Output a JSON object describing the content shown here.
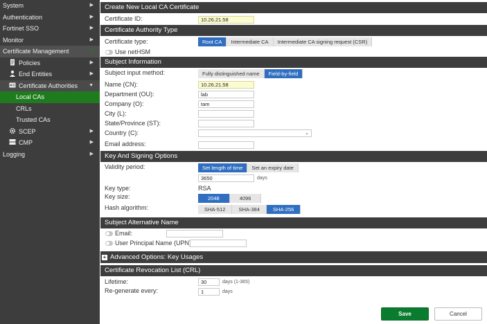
{
  "sidebar": {
    "items": [
      {
        "label": "System"
      },
      {
        "label": "Authentication"
      },
      {
        "label": "Fortinet SSO"
      },
      {
        "label": "Monitor"
      },
      {
        "label": "Certificate Management"
      },
      {
        "label": "Policies"
      },
      {
        "label": "End Entities"
      },
      {
        "label": "Certificate Authorities"
      },
      {
        "label": "Local CAs"
      },
      {
        "label": "CRLs"
      },
      {
        "label": "Trusted CAs"
      },
      {
        "label": "SCEP"
      },
      {
        "label": "CMP"
      },
      {
        "label": "Logging"
      }
    ]
  },
  "form": {
    "title": "Create New Local CA Certificate",
    "cert_id_label": "Certificate ID:",
    "cert_id_value": "10.26.21.58",
    "cat_section": "Certificate Authority Type",
    "cert_type_label": "Certificate type:",
    "cert_types": [
      "Root CA",
      "Intermediate CA",
      "Intermediate CA signing request (CSR)"
    ],
    "use_nethsm": "Use netHSM",
    "subject_section": "Subject Information",
    "subject_method_label": "Subject input method:",
    "subject_methods": [
      "Fully distinguished name",
      "Field-by-field"
    ],
    "name_label": "Name (CN):",
    "name_value": "10.26.21.58",
    "dept_label": "Department (OU):",
    "dept_value": "lab",
    "company_label": "Company (O):",
    "company_value": "tam",
    "city_label": "City (L):",
    "city_value": "",
    "state_label": "State/Province (ST):",
    "state_value": "",
    "country_label": "Country (C):",
    "country_value": "",
    "email_label": "Email address:",
    "email_value": "",
    "key_section": "Key And Signing Options",
    "validity_label": "Validity period:",
    "validity_options": [
      "Set length of time",
      "Set an expiry date"
    ],
    "validity_value": "3650",
    "validity_unit": "days",
    "key_type_label": "Key type:",
    "key_type_value": "RSA",
    "key_size_label": "Key size:",
    "key_sizes": [
      "2048",
      "4096"
    ],
    "hash_label": "Hash algorithm:",
    "hashes": [
      "SHA-512",
      "SHA-384",
      "SHA-256"
    ],
    "san_section": "Subject Alternative Name",
    "san_email_label": "Email:",
    "san_email_value": "",
    "san_upn_label": "User Principal Name (UPN):",
    "san_upn_value": "",
    "adv_section": "Advanced Options: Key Usages",
    "crl_section": "Certificate Revocation List (CRL)",
    "lifetime_label": "Lifetime:",
    "lifetime_value": "30",
    "lifetime_unit": "days (1-365)",
    "regen_label": "Re-generate every:",
    "regen_value": "1",
    "regen_unit": "days",
    "save_label": "Save",
    "cancel_label": "Cancel"
  },
  "colors": {
    "sidebar_bg": "#3d3d3d",
    "active_green": "#1e7c1e",
    "selected_blue": "#2f6ec0",
    "save_green": "#0a7c2f"
  }
}
